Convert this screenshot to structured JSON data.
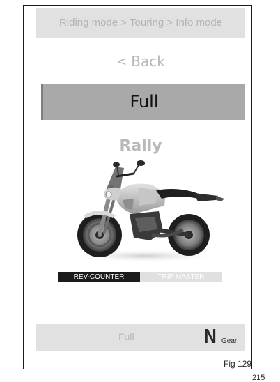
{
  "header": {
    "breadcrumb": "Riding mode > Touring > Info mode"
  },
  "menu": {
    "back_chevron": "<",
    "back_label": "Back",
    "selected_item": "Full",
    "next_item": "Rally"
  },
  "display_tabs": {
    "active": "REV-COUNTER",
    "inactive": "TRIP MASTER"
  },
  "status_bar": {
    "mode": "Full",
    "gear_value": "N",
    "gear_label": "Gear"
  },
  "caption": {
    "figure": "Fig 129",
    "page": "215"
  },
  "icons": {
    "motorcycle": "motorcycle-image"
  },
  "colors": {
    "bar_background": "#e1e1e1",
    "selected_background": "#a9a9a9",
    "active_tab": "#1c1c1c",
    "inactive_tab": "#e0e0e0"
  }
}
